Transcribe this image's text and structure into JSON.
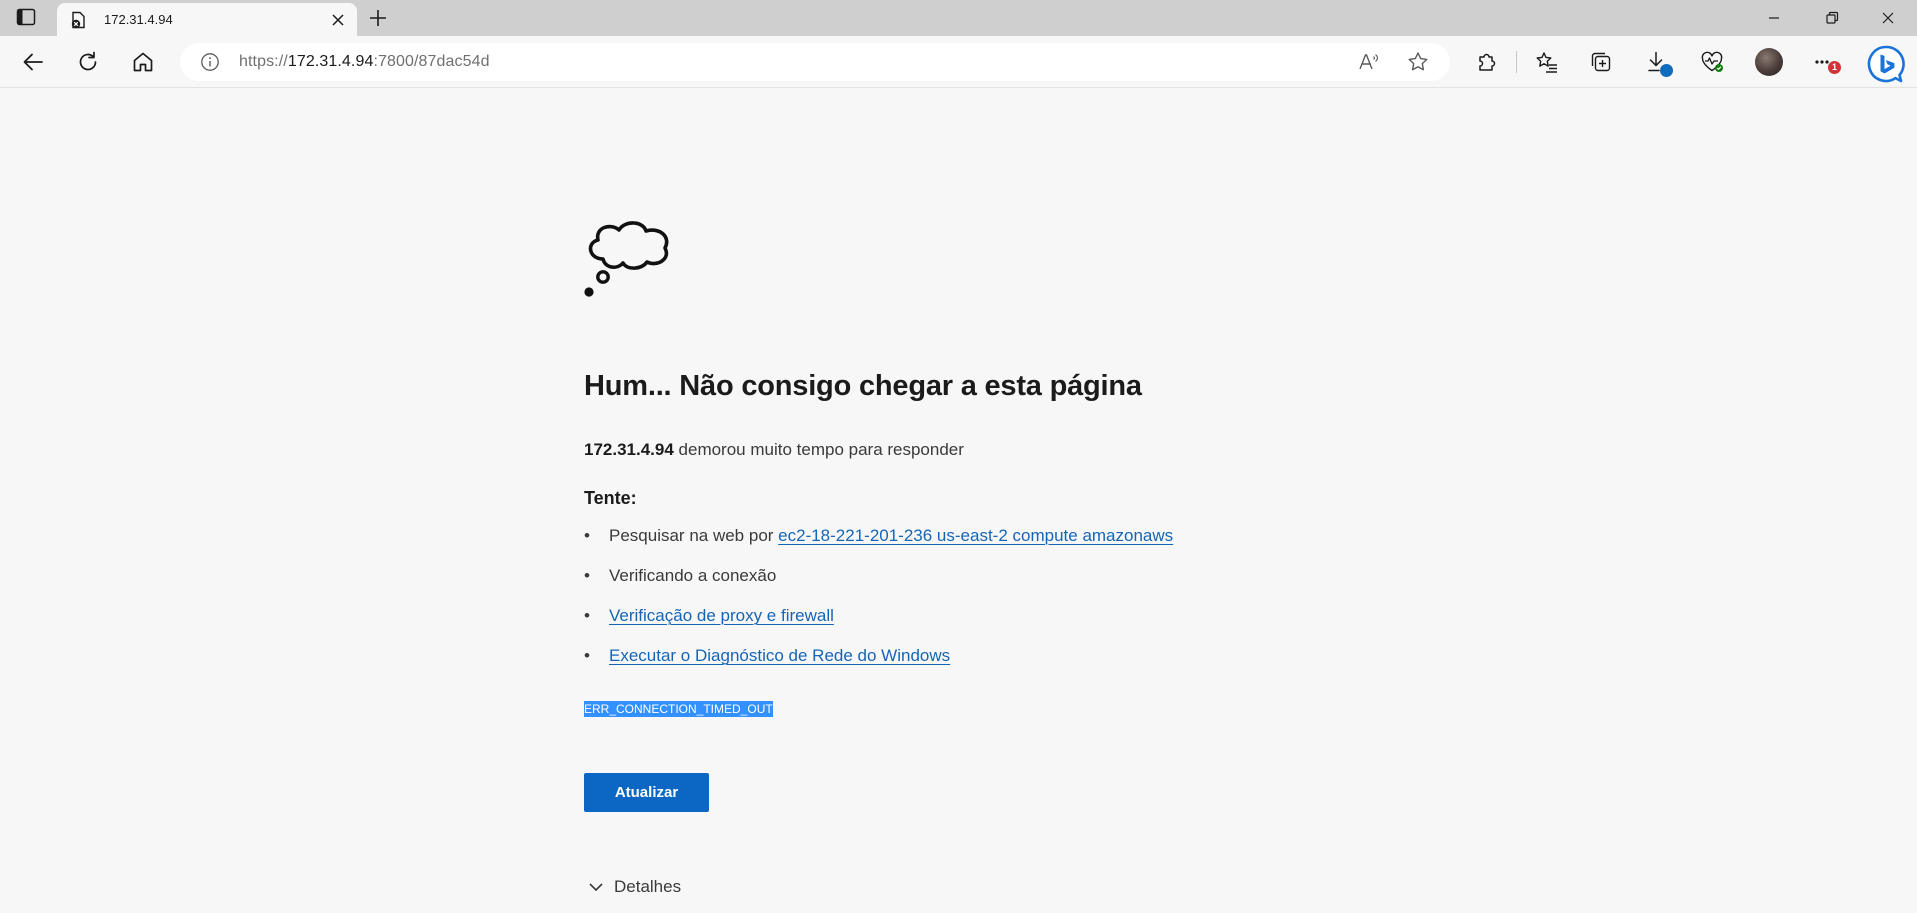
{
  "tab": {
    "title": "172.31.4.94"
  },
  "address": {
    "scheme": "https://",
    "host": "172.31.4.94",
    "rest": ":7800/87dac54d"
  },
  "toolbar": {
    "download_badge": "",
    "more_badge": "1"
  },
  "error": {
    "heading": "Hum... Não consigo chegar a esta página",
    "host": "172.31.4.94",
    "message": " demorou muito tempo para responder",
    "try_label": "Tente:",
    "suggestions": {
      "search_prefix": "Pesquisar na web por ",
      "search_link": "ec2-18-221-201-236 us-east-2 compute amazonaws",
      "checking": "Verificando a conexão",
      "proxy": "Verificação de proxy e firewall",
      "diagnostics": "Executar o Diagnóstico de Rede do Windows"
    },
    "code": "ERR_CONNECTION_TIMED_OUT",
    "refresh_button": "Atualizar",
    "details": "Detalhes"
  },
  "colors": {
    "accent": "#0b67c3",
    "link": "#1565b7",
    "selection": "#3390ff",
    "badge_red": "#d13438",
    "badge_blue": "#0f6cbd"
  }
}
